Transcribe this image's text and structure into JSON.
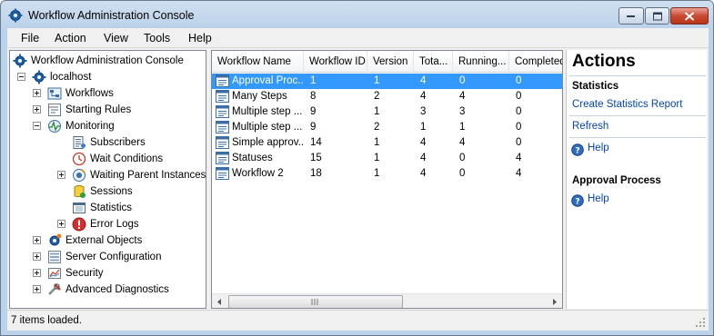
{
  "window": {
    "title": "Workflow Administration Console"
  },
  "menu": [
    "File",
    "Action",
    "View",
    "Tools",
    "Help"
  ],
  "tree": [
    {
      "label": "Workflow Administration Console",
      "icon": "gear-icon",
      "level": 0,
      "expander": "none"
    },
    {
      "label": "localhost",
      "icon": "gear-icon",
      "level": 1,
      "expander": "minus"
    },
    {
      "label": "Workflows",
      "icon": "workflow-icon",
      "level": 2,
      "expander": "plus"
    },
    {
      "label": "Starting Rules",
      "icon": "rules-icon",
      "level": 2,
      "expander": "plus"
    },
    {
      "label": "Monitoring",
      "icon": "monitoring-icon",
      "level": 2,
      "expander": "minus"
    },
    {
      "label": "Subscribers",
      "icon": "subscribers-icon",
      "level": 3,
      "expander": "none"
    },
    {
      "label": "Wait Conditions",
      "icon": "clock-icon",
      "level": 3,
      "expander": "none"
    },
    {
      "label": "Waiting Parent Instances",
      "icon": "parent-instances-icon",
      "level": 3,
      "expander": "plus"
    },
    {
      "label": "Sessions",
      "icon": "sessions-icon",
      "level": 3,
      "expander": "none"
    },
    {
      "label": "Statistics",
      "icon": "statistics-icon",
      "level": 3,
      "expander": "none"
    },
    {
      "label": "Error Logs",
      "icon": "error-icon",
      "level": 3,
      "expander": "plus"
    },
    {
      "label": "External Objects",
      "icon": "external-objects-icon",
      "level": 2,
      "expander": "plus"
    },
    {
      "label": "Server Configuration",
      "icon": "server-config-icon",
      "level": 2,
      "expander": "plus"
    },
    {
      "label": "Security",
      "icon": "security-icon",
      "level": 2,
      "expander": "plus"
    },
    {
      "label": "Advanced Diagnostics",
      "icon": "tools-icon",
      "level": 2,
      "expander": "plus"
    }
  ],
  "table": {
    "columns": [
      "Workflow Name",
      "Workflow ID",
      "Version",
      "Tota...",
      "Running...",
      "Completed"
    ],
    "rows": [
      [
        "Approval Proc...",
        "1",
        "1",
        "4",
        "0",
        "0"
      ],
      [
        "Many Steps",
        "8",
        "2",
        "4",
        "4",
        "0"
      ],
      [
        "Multiple step ...",
        "9",
        "1",
        "3",
        "3",
        "0"
      ],
      [
        "Multiple step ...",
        "9",
        "2",
        "1",
        "1",
        "0"
      ],
      [
        "Simple approv...",
        "14",
        "1",
        "4",
        "4",
        "0"
      ],
      [
        "Statuses",
        "15",
        "1",
        "4",
        "0",
        "4"
      ],
      [
        "Workflow 2",
        "18",
        "1",
        "4",
        "0",
        "4"
      ]
    ],
    "selected_row": 0
  },
  "actions": {
    "title": "Actions",
    "section1": "Statistics",
    "create_report": "Create Statistics Report",
    "refresh": "Refresh",
    "help1": "Help",
    "section2": "Approval Process",
    "help2": "Help"
  },
  "status": "7 items loaded.",
  "colors": {
    "selection": "#3399ff",
    "link": "#0645ad"
  }
}
